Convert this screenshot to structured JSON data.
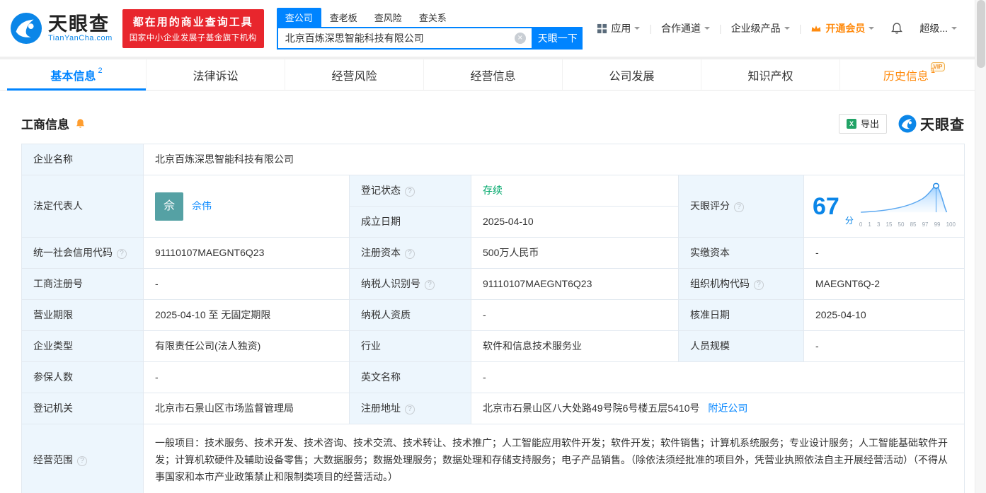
{
  "header": {
    "logo": {
      "brand": "天眼查",
      "domain": "TianYanCha.com"
    },
    "slogan_line1": "都在用的商业查询工具",
    "slogan_line2": "国家中小企业发展子基金旗下机构",
    "search": {
      "tabs": [
        {
          "label": "查公司"
        },
        {
          "label": "查老板"
        },
        {
          "label": "查风险"
        },
        {
          "label": "查关系"
        }
      ],
      "value": "北京百炼深思智能科技有限公司",
      "button": "天眼一下"
    },
    "nav": {
      "apps": "应用",
      "partner": "合作通道",
      "enterprise": "企业级产品",
      "vip": "开通会员",
      "account": "超级..."
    }
  },
  "tabs": [
    {
      "label": "基本信息",
      "badge": "2"
    },
    {
      "label": "法律诉讼"
    },
    {
      "label": "经营风险"
    },
    {
      "label": "经营信息"
    },
    {
      "label": "公司发展"
    },
    {
      "label": "知识产权"
    },
    {
      "label": "历史信息",
      "badge": "1",
      "tag": "VIP"
    }
  ],
  "section": {
    "title": "工商信息",
    "export": "导出",
    "brand": "天眼查"
  },
  "info": {
    "company_name": {
      "label": "企业名称",
      "value": "北京百炼深思智能科技有限公司"
    },
    "legal_rep": {
      "label": "法定代表人",
      "avatar": "佘",
      "name": "佘伟"
    },
    "reg_status": {
      "label": "登记状态",
      "value": "存续"
    },
    "establish_date": {
      "label": "成立日期",
      "value": "2025-04-10"
    },
    "score": {
      "label": "天眼评分",
      "value": "67",
      "unit": "分",
      "ticks": [
        "0",
        "1",
        "3",
        "15",
        "50",
        "85",
        "97",
        "99",
        "100"
      ]
    },
    "credit_code": {
      "label": "统一社会信用代码",
      "value": "91110107MAEGNT6Q23"
    },
    "reg_capital": {
      "label": "注册资本",
      "value": "500万人民币"
    },
    "paid_capital": {
      "label": "实缴资本",
      "value": "-"
    },
    "reg_no": {
      "label": "工商注册号",
      "value": "-"
    },
    "taxpayer_no": {
      "label": "纳税人识别号",
      "value": "91110107MAEGNT6Q23"
    },
    "org_code": {
      "label": "组织机构代码",
      "value": "MAEGNT6Q-2"
    },
    "business_term": {
      "label": "营业期限",
      "value": "2025-04-10 至 无固定期限"
    },
    "taxpayer_quality": {
      "label": "纳税人资质",
      "value": "-"
    },
    "approval_date": {
      "label": "核准日期",
      "value": "2025-04-10"
    },
    "company_type": {
      "label": "企业类型",
      "value": "有限责任公司(法人独资)"
    },
    "industry": {
      "label": "行业",
      "value": "软件和信息技术服务业"
    },
    "staff_size": {
      "label": "人员规模",
      "value": "-"
    },
    "insured_num": {
      "label": "参保人数",
      "value": "-"
    },
    "english_name": {
      "label": "英文名称",
      "value": "-"
    },
    "reg_authority": {
      "label": "登记机关",
      "value": "北京市石景山区市场监督管理局"
    },
    "reg_address": {
      "label": "注册地址",
      "value": "北京市石景山区八大处路49号院6号楼五层5410号",
      "link": "附近公司"
    },
    "business_scope": {
      "label": "经营范围",
      "value": "一般项目：技术服务、技术开发、技术咨询、技术交流、技术转让、技术推广；人工智能应用软件开发；软件开发；软件销售；计算机系统服务；专业设计服务；人工智能基础软件开发；计算机软硬件及辅助设备零售；大数据服务；数据处理服务；数据处理和存储支持服务；电子产品销售。（除依法须经批准的项目外，凭营业执照依法自主开展经营活动）（不得从事国家和本市产业政策禁止和限制类项目的经营活动。）"
    }
  },
  "colors": {
    "primary": "#0084ff",
    "orange": "#ff8b0f",
    "red": "#e8262d",
    "green": "#00a86b"
  }
}
